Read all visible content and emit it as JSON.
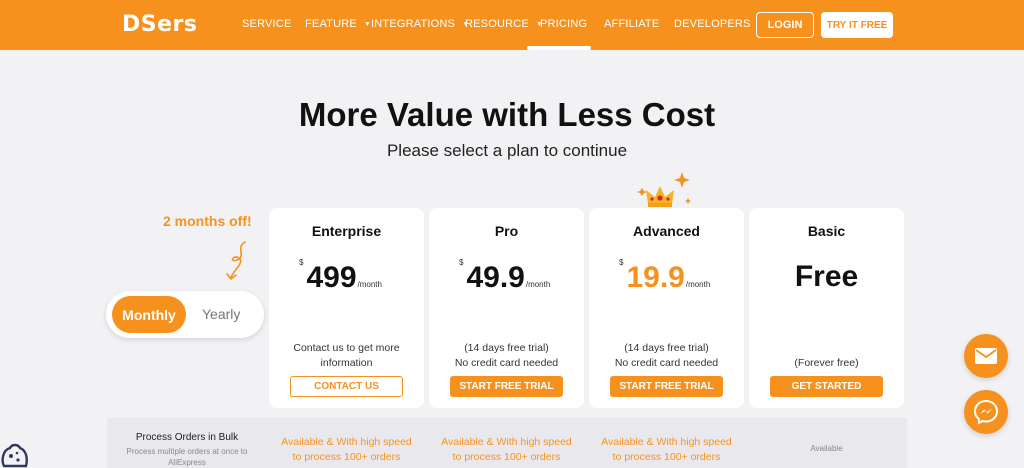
{
  "brand": {
    "logo": "DSers",
    "accent": "#f7911e"
  },
  "nav": {
    "items": [
      {
        "label": "SERVICE",
        "caret": false
      },
      {
        "label": "FEATURE",
        "caret": true
      },
      {
        "label": "INTEGRATIONS",
        "caret": true
      },
      {
        "label": "RESOURCE",
        "caret": true
      },
      {
        "label": "PRICING",
        "caret": false,
        "active": true
      },
      {
        "label": "AFFILIATE",
        "caret": false
      },
      {
        "label": "DEVELOPERS",
        "caret": false
      }
    ],
    "login": "LOGIN",
    "try": "TRY IT FREE"
  },
  "hero": {
    "title": "More Value with Less Cost",
    "subtitle": "Please select a plan to continue"
  },
  "billing": {
    "promo": "2 months off!",
    "options": [
      "Monthly",
      "Yearly"
    ],
    "selected": "Monthly"
  },
  "plans": [
    {
      "name": "Enterprise",
      "currency": "$",
      "price": "499",
      "period": "/month",
      "notes": [
        "Contact us to get more",
        "information"
      ],
      "cta": "CONTACT US",
      "cta_style": "outline"
    },
    {
      "name": "Pro",
      "currency": "$",
      "price": "49.9",
      "period": "/month",
      "notes": [
        "(14 days free trial)",
        "No credit card needed"
      ],
      "cta": "START FREE TRIAL",
      "cta_style": "solid"
    },
    {
      "name": "Advanced",
      "currency": "$",
      "price": "19.9",
      "period": "/month",
      "notes": [
        "(14 days free trial)",
        "No credit card needed"
      ],
      "cta": "START FREE TRIAL",
      "cta_style": "solid",
      "highlight": true
    },
    {
      "name": "Basic",
      "price": "Free",
      "notes": [
        "(Forever free)"
      ],
      "cta": "GET STARTED",
      "cta_style": "solid"
    }
  ],
  "features": [
    {
      "title": "Process Orders in Bulk",
      "subtitle": [
        "Process multiple orders at once to",
        "AliExpress"
      ],
      "enterprise": [
        "Available & With high speed",
        "to process 100+ orders"
      ],
      "pro": [
        "Available & With high speed",
        "to process 100+ orders"
      ],
      "advanced": [
        "Available & With high speed",
        "to process 100+ orders"
      ],
      "basic": "Available"
    }
  ],
  "floating": {
    "mail": "mail-icon",
    "messenger": "messenger-icon",
    "cookie": "cookie-icon"
  }
}
